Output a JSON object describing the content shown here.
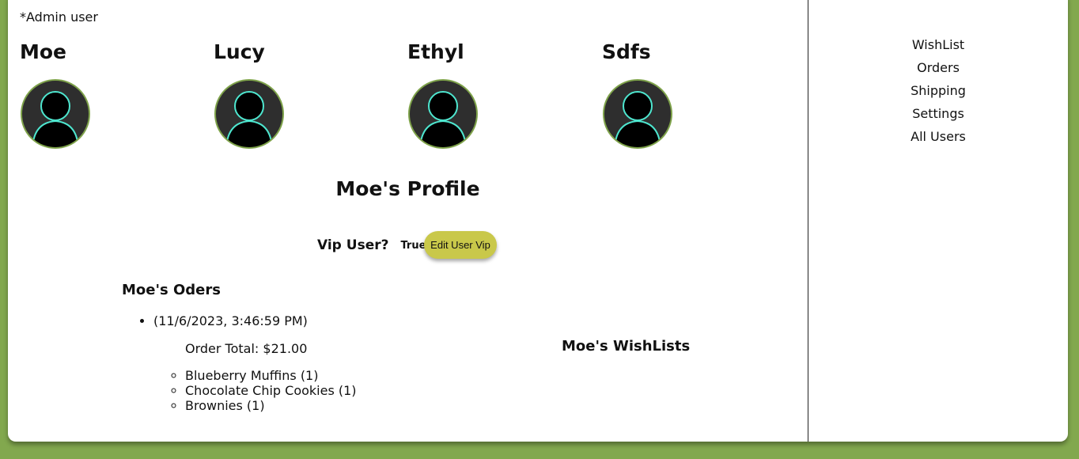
{
  "admin_note": "*Admin user",
  "users": [
    {
      "name": "Moe"
    },
    {
      "name": "Lucy"
    },
    {
      "name": "Ethyl"
    },
    {
      "name": "Sdfs"
    }
  ],
  "profile": {
    "title": "Moe's Profile",
    "vip_label": "Vip User?",
    "vip_value": "True",
    "edit_vip_button": "Edit User Vip"
  },
  "orders": {
    "heading": "Moe's Oders",
    "items": [
      {
        "date": "(11/6/2023, 3:46:59 PM)",
        "total": "Order Total: $21.00",
        "products": [
          "Blueberry Muffins (1)",
          "Chocolate Chip Cookies (1)",
          "Brownies (1)"
        ]
      }
    ]
  },
  "wishlists": {
    "heading": "Moe's WishLists"
  },
  "sidebar": {
    "items": [
      {
        "label": "WishList"
      },
      {
        "label": "Orders"
      },
      {
        "label": "Shipping"
      },
      {
        "label": "Settings"
      },
      {
        "label": "All Users"
      }
    ]
  },
  "colors": {
    "page_background": "#82a84e",
    "avatar_ring": "#7ea24a",
    "avatar_outline": "#4ee6cf",
    "avatar_bg": "#2e2e2e",
    "vip_button": "#c9c84a"
  }
}
